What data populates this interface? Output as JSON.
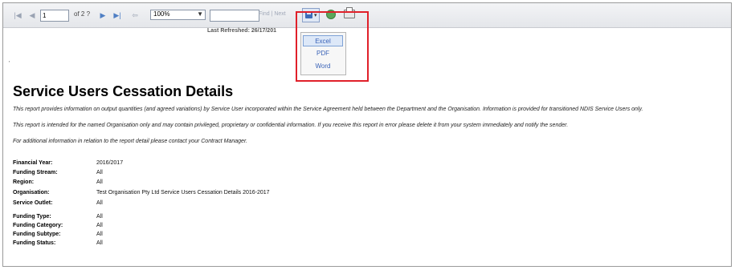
{
  "toolbar": {
    "page_number": "1",
    "page_of": "of 2 ?",
    "zoom": "100%",
    "find_text": "",
    "find_label": "Find",
    "separator": "|",
    "next_label": "Next",
    "first_icon": "first-page-icon",
    "prev_icon": "prev-page-icon",
    "next_icon": "next-page-icon",
    "last_icon": "last-page-icon",
    "back_icon": "back-icon",
    "export_icon": "save-export-icon",
    "refresh_icon": "refresh-icon",
    "print_icon": "print-icon"
  },
  "export_menu": {
    "items": [
      "Excel",
      "PDF",
      "Word"
    ],
    "selected": "Excel",
    "highlight_color": "#e0202a"
  },
  "last_refreshed": "Last Refreshed: 26/17/201",
  "report": {
    "marker": "'",
    "title": "Service Users Cessation Details",
    "paragraphs": [
      "This report provides information on output quantities (and agreed variations) by Service User incorporated within the Service Agreement held between the Department and the Organisation. Information is provided for transitioned NDIS Service Users only.",
      "This report is intended for the named Organisation only and may contain privileged, proprietary or confidential information. If you receive this report in error please delete it from your system immediately and notify the sender.",
      "For additional information in relation to the report detail please contact your Contract Manager."
    ],
    "parameters": [
      {
        "label": "Financial Year:",
        "value": "2016/2017"
      },
      {
        "label": "Funding Stream:",
        "value": "All"
      },
      {
        "label": "Region:",
        "value": "All"
      },
      {
        "label": "Organisation:",
        "value": "Test Organisation  Pty Ltd Service Users Cessation Details 2016-2017"
      },
      {
        "label": "Service Outlet:",
        "value": "All"
      },
      {
        "label": "Funding Type:",
        "value": "All"
      },
      {
        "label": "Funding Category:",
        "value": "All"
      },
      {
        "label": "Funding Subtype:",
        "value": "All"
      },
      {
        "label": "Funding Status:",
        "value": "All"
      }
    ]
  }
}
